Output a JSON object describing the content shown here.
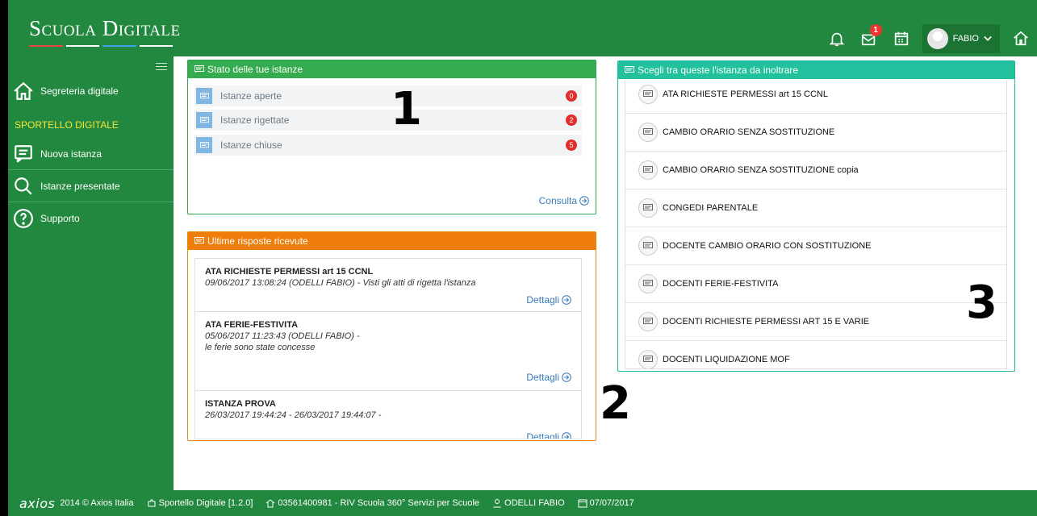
{
  "header": {
    "brand": "Scuola Digitale",
    "brand_line_colors": [
      "#e84545",
      "#ffffff",
      "#3aa0e8",
      "#ffffff"
    ],
    "notification_badge": "1",
    "user_name": "FABIO"
  },
  "sidebar": {
    "items": [
      {
        "label": "Segreteria digitale",
        "icon": "home-icon"
      },
      {
        "label": "Nuova istanza",
        "icon": "comment-icon"
      },
      {
        "label": "Istanze presentate",
        "icon": "search-icon"
      },
      {
        "label": "Supporto",
        "icon": "help-icon"
      }
    ],
    "section_label": "SPORTELLO DIGITALE"
  },
  "panel_status": {
    "title": "Stato delle tue istanze",
    "rows": [
      {
        "label": "Istanze aperte",
        "count": "0"
      },
      {
        "label": "Istanze rigettate",
        "count": "2"
      },
      {
        "label": "Istanze chiuse",
        "count": "5"
      }
    ],
    "link": "Consulta"
  },
  "panel_responses": {
    "title": "Ultime risposte ricevute",
    "items": [
      {
        "title": "ATA RICHIESTE PERMESSI art 15 CCNL",
        "line1": "09/06/2017 13:08:24 (ODELLI FABIO) - Visti gli atti di rigetta l'istanza",
        "line2": "",
        "link": "Dettagli"
      },
      {
        "title": "ATA FERIE-FESTIVITA",
        "line1": "05/06/2017 11:23:43 (ODELLI FABIO) -",
        "line2": "le ferie sono state concesse",
        "link": "Dettagli"
      },
      {
        "title": "ISTANZA PROVA",
        "line1": "26/03/2017 19:44:24 - 26/03/2017 19:44:07 -",
        "line2": "",
        "link": "Dettagli"
      }
    ]
  },
  "panel_choose": {
    "title": "Scegli tra queste l'istanza da inoltrare",
    "items": [
      "ATA RICHIESTE PERMESSI art 15 CCNL",
      "CAMBIO ORARIO SENZA SOSTITUZIONE",
      "CAMBIO ORARIO SENZA SOSTITUZIONE copia",
      "CONGEDI PARENTALE",
      "DOCENTE CAMBIO ORARIO CON SOSTITUZIONE",
      "DOCENTI FERIE-FESTIVITA",
      "DOCENTI RICHIESTE PERMESSI ART 15 E VARIE",
      "DOCENTI LIQUIDAZIONE MOF"
    ]
  },
  "annotations": [
    "1",
    "2",
    "3"
  ],
  "footer": {
    "logo": "axios",
    "copyright": "2014 © Axios Italia",
    "app": "Sportello Digitale [1.2.0]",
    "school": "03561400981 - RIV Scuola 360° Servizi per Scuole",
    "user": "ODELLI FABIO",
    "date": "07/07/2017"
  },
  "colors": {
    "primary_green": "#23883f",
    "status_panel": "#35ac4f",
    "responses_panel": "#ee7d0c",
    "choose_panel": "#22c19d",
    "active_section": "#f5e53a",
    "badge_red": "#e02e2e",
    "link_blue": "#3a7ab8"
  }
}
